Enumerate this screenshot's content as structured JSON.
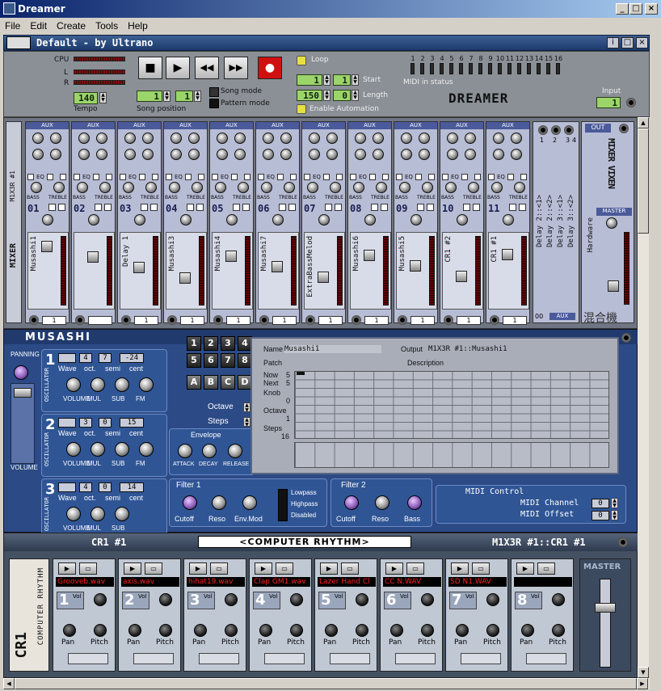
{
  "window": {
    "title": "Dreamer",
    "min": "_",
    "max": "□",
    "close": "×"
  },
  "menu": [
    "File",
    "Edit",
    "Create",
    "Tools",
    "Help"
  ],
  "doc": {
    "title": "Default - by Ultrano",
    "info": "i",
    "restore": "□",
    "close": "×"
  },
  "transport": {
    "cpu_label": "CPU",
    "l_label": "L",
    "r_label": "R",
    "tempo_value": "140",
    "tempo_label": "Tempo",
    "song_pos_a": "1",
    "song_pos_b": "1",
    "song_pos_label": "Song position",
    "song_mode": "Song mode",
    "pattern_mode": "Pattern mode",
    "stop": "■",
    "play": "▶",
    "rewind": "◀◀",
    "forward": "▶▶",
    "record": "●",
    "loop_label": "Loop",
    "start_a": "1",
    "start_b": "1",
    "start_label": "Start",
    "length_a": "150",
    "length_b": "0",
    "length_label": "Length",
    "automation_label": "Enable Automation",
    "midi_channels": [
      "1",
      "2",
      "3",
      "4",
      "5",
      "6",
      "7",
      "8",
      "9",
      "10",
      "11",
      "12",
      "13",
      "14",
      "15",
      "16"
    ],
    "midi_status": "MIDI in status",
    "logo": "DREAMER",
    "input_label": "Input",
    "input_value": "1"
  },
  "mixer": {
    "side_title": "M1X3R #1",
    "side_logo": "MIXER",
    "aux": "AUX",
    "eq": "EQ",
    "bass": "BASS",
    "treble": "TREBLE",
    "channels": [
      {
        "num": "01",
        "name": "Musashi1",
        "out": "1"
      },
      {
        "num": "02",
        "name": "",
        "out": ""
      },
      {
        "num": "03",
        "name": "Delay 1",
        "out": "1"
      },
      {
        "num": "04",
        "name": "Musashi3",
        "out": "1"
      },
      {
        "num": "05",
        "name": "Musashi4",
        "out": "1"
      },
      {
        "num": "06",
        "name": "Musashi7",
        "out": "1"
      },
      {
        "num": "07",
        "name": "ExtraBassMelod",
        "out": "1"
      },
      {
        "num": "08",
        "name": "Musashi6",
        "out": "1"
      },
      {
        "num": "09",
        "name": "Musashi5",
        "out": "1"
      },
      {
        "num": "10",
        "name": "CR1 #2",
        "out": "1"
      },
      {
        "num": "11",
        "name": "CR1 #1",
        "out": "1"
      }
    ],
    "aux_returns": [
      "Delay 2::<1>",
      "Delay 2::<2>",
      "Delay 3::<1>",
      "Delay 3::<2>"
    ],
    "aux_jacks": [
      "1",
      "2",
      "3",
      "4"
    ],
    "aux_footer": "AUX",
    "aux_zero": "00",
    "out_label": "OUT",
    "master_label": "MASTER",
    "hardware": "Hardware",
    "brand": "MIXER VIXEN",
    "kanji": "混合機"
  },
  "musashi": {
    "title": "MUSASHI",
    "panning": "PANNING",
    "volume": "VOLUME",
    "oscillator": "OSCILLATOR",
    "osc": [
      {
        "n": "1",
        "oct": "4",
        "semi": "7",
        "cent": "-24"
      },
      {
        "n": "2",
        "oct": "3",
        "semi": "0",
        "cent": "15"
      },
      {
        "n": "3",
        "oct": "4",
        "semi": "0",
        "cent": "14"
      }
    ],
    "wave": "Wave",
    "oct": "oct.",
    "semi": "semi",
    "cent": "cent",
    "vol": "VOLUME",
    "mul": "MUL",
    "sub": "SUB",
    "fm": "FM",
    "keys": [
      "1",
      "2",
      "3",
      "4",
      "5",
      "6",
      "7",
      "8"
    ],
    "letters": [
      "A",
      "B",
      "C",
      "D"
    ],
    "octave": "Octave",
    "steps": "Steps",
    "envelope": "Envelope",
    "attack": "ATTACK",
    "decay": "DECAY",
    "release": "RELEASE",
    "filter1": "Filter 1",
    "cutoff": "Cutoff",
    "reso": "Reso",
    "envmod": "Env.Mod",
    "lowpass": "Lowpass",
    "highpass": "Highpass",
    "disabled": "Disabled",
    "filter2": "Filter 2",
    "bass": "Bass",
    "midi_control": "MIDI Control",
    "midi_channel": "MIDI Channel",
    "midi_offset": "MIDI Offset",
    "midi_channel_val": "0",
    "midi_offset_val": "0",
    "pattern": {
      "name_label": "Name",
      "name": "Musashi1",
      "output_label": "Output",
      "output": "M1X3R #1::Musashi1",
      "patch_label": "Patch",
      "desc_label": "Description",
      "now_label": "Now",
      "now": "5",
      "next_label": "Next",
      "next": "5",
      "knob_label": "Knob",
      "knob": "0",
      "octave_label": "Octave",
      "octave": "1",
      "steps_label": "Steps",
      "steps": "16"
    }
  },
  "rhythm": {
    "title": "CR1 #1",
    "banner": "<COMPUTER RHYTHM>",
    "route": "M1X3R #1::CR1 #1",
    "side_logo": "COMPUTER RHYTHM",
    "cr": "CR1",
    "pads": [
      {
        "n": "1",
        "wav": "Grooveb.wav"
      },
      {
        "n": "2",
        "wav": "axis.wav"
      },
      {
        "n": "3",
        "wav": "hihat19.wav"
      },
      {
        "n": "4",
        "wav": "Clap  GM1.wav"
      },
      {
        "n": "5",
        "wav": "Lazer Hand Cl"
      },
      {
        "n": "6",
        "wav": "CC  N.WAV"
      },
      {
        "n": "7",
        "wav": "SD  N1.WAV"
      },
      {
        "n": "8",
        "wav": ""
      }
    ],
    "vol": "Vol",
    "pan": "Pan",
    "pitch": "Pitch",
    "master": "MASTER"
  }
}
